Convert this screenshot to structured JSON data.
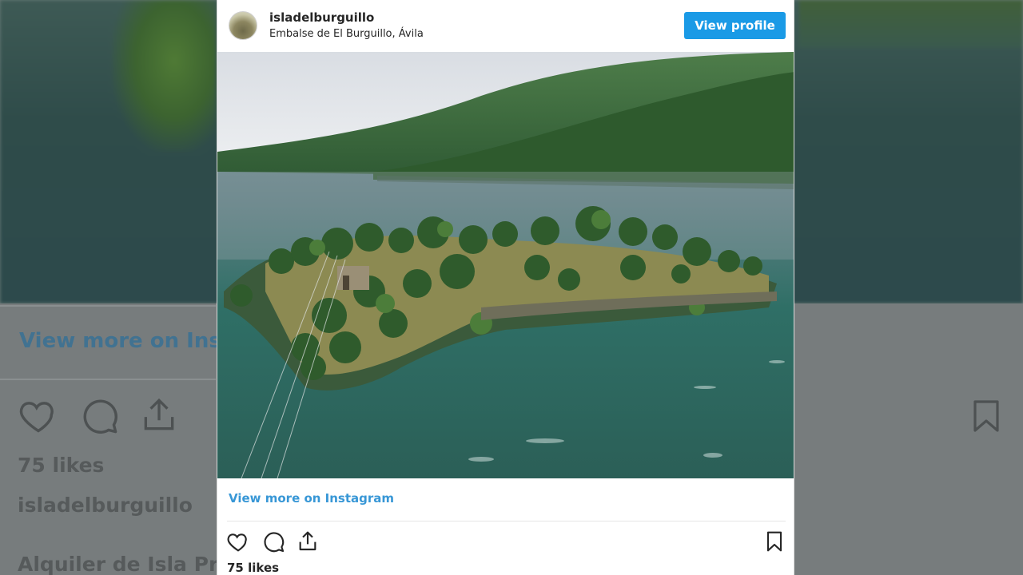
{
  "post": {
    "username": "isladelburguillo",
    "location": "Embalse de El Burguillo, Ávila",
    "view_profile_label": "View profile",
    "view_more_label": "View more on Instagram",
    "likes": "75 likes"
  },
  "backdrop": {
    "link_text": "View more on Ins",
    "likes": "75 likes",
    "username": "isladelburguillo",
    "caption_fragment": "Alquiler de Isla Pr"
  },
  "icons": {
    "like": "heart-icon",
    "comment": "comment-icon",
    "share": "share-icon",
    "save": "bookmark-icon"
  },
  "colors": {
    "accent": "#1a9ae6",
    "link": "#3897d6",
    "text": "#262626"
  }
}
